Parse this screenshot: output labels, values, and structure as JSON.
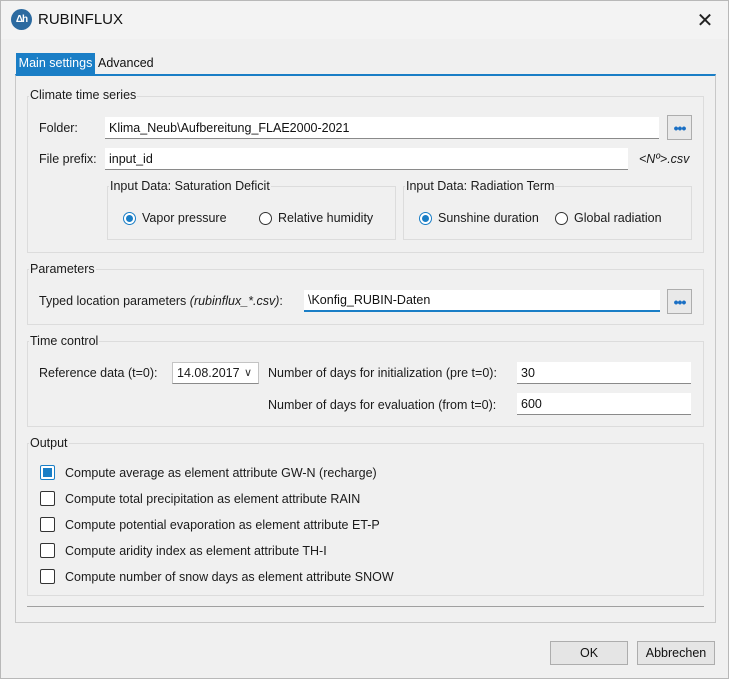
{
  "window": {
    "title": "RUBINFLUX",
    "close_label": "✕",
    "app_icon_label": "Δh"
  },
  "tabs": [
    {
      "label": "Main settings",
      "active": true
    },
    {
      "label": "Advanced",
      "active": false
    }
  ],
  "climate": {
    "title": "Climate time series",
    "folder_label": "Folder:",
    "folder_value": "Klima_Neub\\Aufbereitung_FLAE2000-2021",
    "file_prefix_label": "File prefix:",
    "file_prefix_value": "input_id",
    "file_suffix": "<Nº>.csv",
    "browse_label": "•••",
    "saturation": {
      "title": "Input Data: Saturation Deficit",
      "options": [
        {
          "label": "Vapor pressure",
          "selected": true
        },
        {
          "label": "Relative humidity",
          "selected": false
        }
      ]
    },
    "radiation": {
      "title": "Input Data: Radiation Term",
      "options": [
        {
          "label": "Sunshine duration",
          "selected": true
        },
        {
          "label": "Global radiation",
          "selected": false
        }
      ]
    }
  },
  "parameters": {
    "title": "Parameters",
    "typed_label": "Typed location parameters ",
    "typed_pattern": "(rubinflux_*.csv)",
    "typed_colon": ":",
    "value": "\\Konfig_RUBIN-Daten",
    "browse_label": "•••"
  },
  "time_control": {
    "title": "Time control",
    "reference_label": "Reference data (t=0):",
    "reference_value": "14.08.2017",
    "init_label": "Number of days for initialization (pre t=0):",
    "init_value": "30",
    "eval_label": "Number of days for evaluation (from t=0):",
    "eval_value": "600"
  },
  "output": {
    "title": "Output",
    "items": [
      {
        "label": "Compute average as element attribute GW-N (recharge)",
        "checked": true
      },
      {
        "label": "Compute total precipitation as element attribute RAIN",
        "checked": false
      },
      {
        "label": "Compute potential evaporation as element attribute ET-P",
        "checked": false
      },
      {
        "label": "Compute aridity index as element attribute TH-I",
        "checked": false
      },
      {
        "label": "Compute number of snow days as element attribute SNOW",
        "checked": false
      }
    ]
  },
  "buttons": {
    "ok": "OK",
    "cancel": "Abbrechen"
  },
  "colors": {
    "accent": "#1a7ec6",
    "background": "#f0f0f0"
  }
}
